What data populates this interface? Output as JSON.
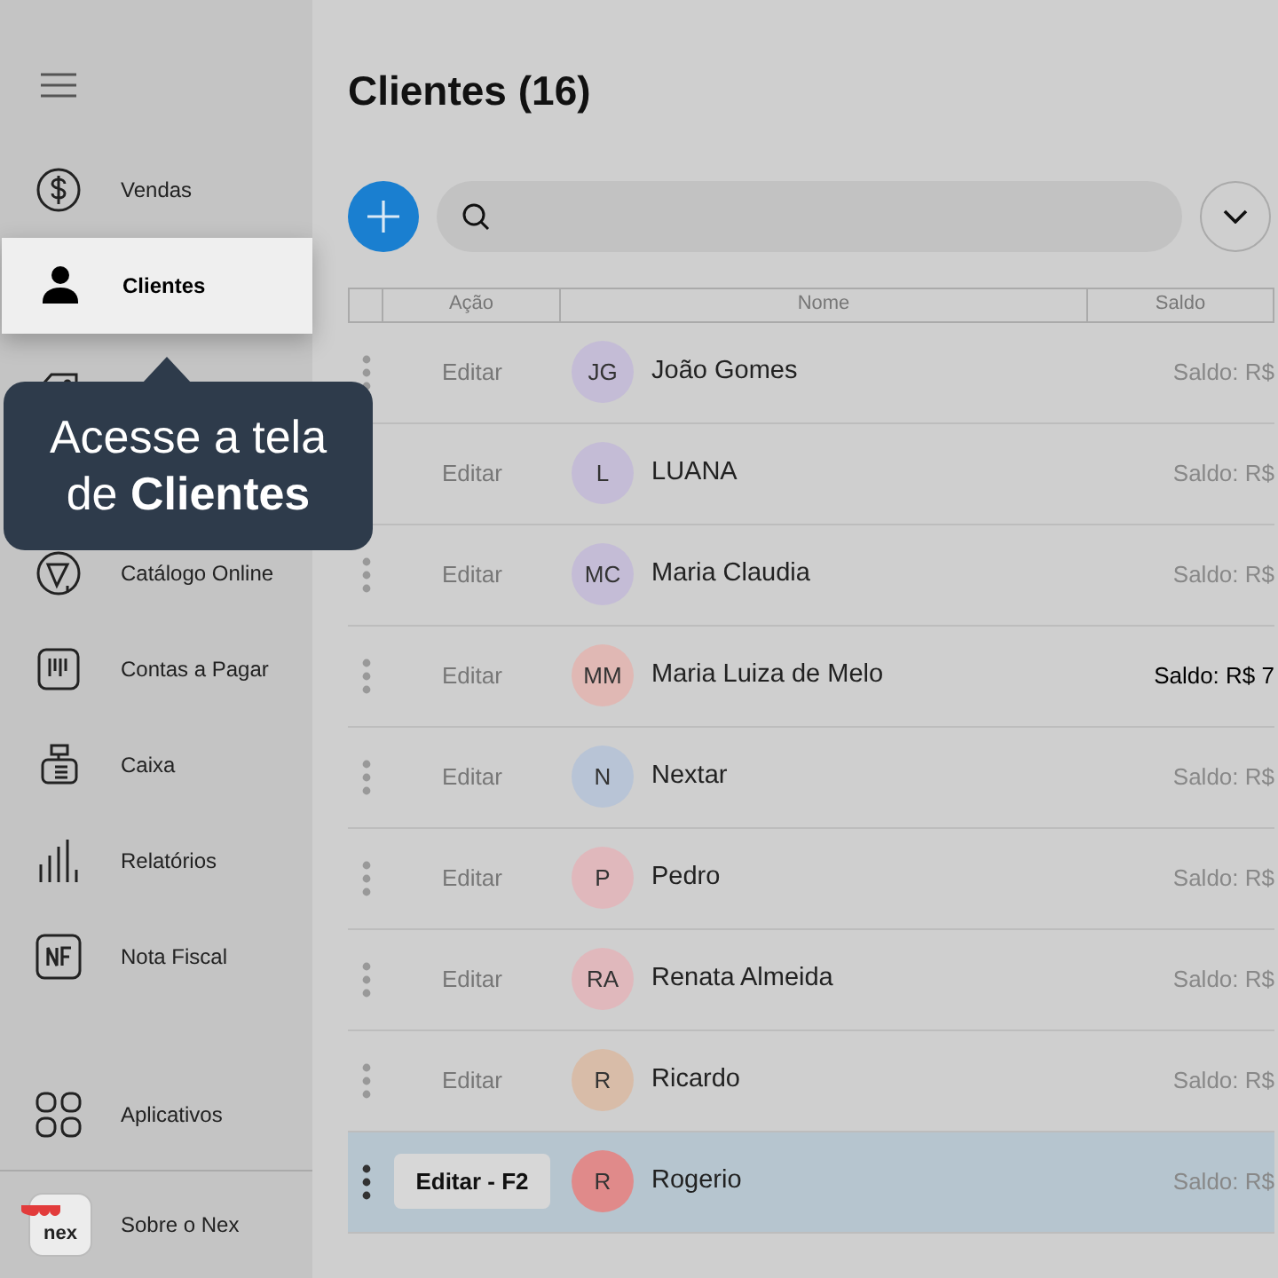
{
  "sidebar": {
    "items": [
      {
        "label": "Vendas",
        "selected": false
      },
      {
        "label": "Clientes",
        "selected": true
      },
      {
        "selected": false
      },
      {
        "label": "Catálogo Online",
        "selected": false
      },
      {
        "label": "Contas a Pagar",
        "selected": false
      },
      {
        "label": "Caixa",
        "selected": false
      },
      {
        "label": "Relatórios",
        "selected": false
      },
      {
        "label": "Nota Fiscal",
        "selected": false
      }
    ],
    "bottom": [
      {
        "label": "Aplicativos"
      },
      {
        "label": "Sobre o Nex",
        "logo_text": "nex"
      }
    ]
  },
  "tooltip": {
    "text": "Acesse a tela de **Clientes**"
  },
  "title": "Clientes (16)",
  "table": {
    "columns": [
      "Ação",
      "Nome",
      "Saldo"
    ],
    "rows": [
      {
        "action": "Editar",
        "initials": "JG",
        "color": "#c4bcd6",
        "name": "João Gomes",
        "balance": "Saldo: R$",
        "highlighted": false,
        "selected": false
      },
      {
        "action": "Editar",
        "initials": "L",
        "color": "#c4bcd6",
        "name": "LUANA",
        "balance": "Saldo: R$",
        "highlighted": false,
        "selected": false
      },
      {
        "action": "Editar",
        "initials": "MC",
        "color": "#c4bcd6",
        "name": "Maria Claudia",
        "balance": "Saldo: R$",
        "highlighted": false,
        "selected": false
      },
      {
        "action": "Editar",
        "initials": "MM",
        "color": "#e0b8b4",
        "name": "Maria Luiza de Melo",
        "balance": "Saldo: R$ 7",
        "highlighted": true,
        "selected": false
      },
      {
        "action": "Editar",
        "initials": "N",
        "color": "#b8c4d6",
        "name": "Nextar",
        "balance": "Saldo: R$",
        "highlighted": false,
        "selected": false
      },
      {
        "action": "Editar",
        "initials": "P",
        "color": "#e0b8bc",
        "name": "Pedro",
        "balance": "Saldo: R$",
        "highlighted": false,
        "selected": false
      },
      {
        "action": "Editar",
        "initials": "RA",
        "color": "#e0b8bc",
        "name": "Renata Almeida",
        "balance": "Saldo: R$",
        "highlighted": false,
        "selected": false
      },
      {
        "action": "Editar",
        "initials": "R",
        "color": "#d8bca8",
        "name": "Ricardo",
        "balance": "Saldo: R$",
        "highlighted": false,
        "selected": false
      },
      {
        "action": "Editar - F2",
        "initials": "R",
        "color": "#e08a8a",
        "name": "Rogerio",
        "balance": "Saldo: R$",
        "highlighted": false,
        "selected": true
      }
    ]
  }
}
